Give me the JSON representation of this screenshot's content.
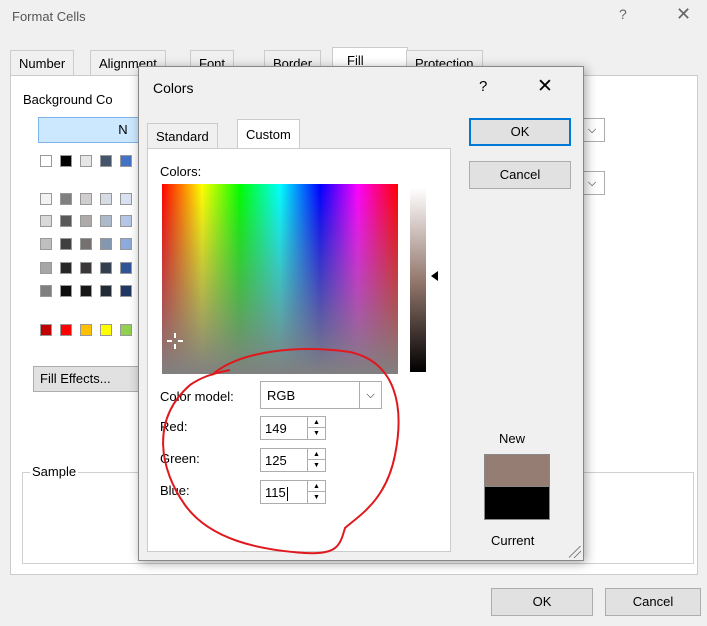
{
  "format_cells": {
    "title": "Format Cells",
    "help": "?",
    "close": "✕",
    "tabs": [
      "Number",
      "Alignment",
      "Font",
      "Border",
      "Fill",
      "Protection"
    ],
    "background_color_label": "Background Co",
    "no_color_label": "N",
    "fill_effects_label": "Fill Effects...",
    "sample_label": "Sample",
    "ok_label": "OK",
    "cancel_label": "Cancel",
    "dropdown_glyph": "⌵"
  },
  "colors_dialog": {
    "title": "Colors",
    "help": "?",
    "close": "✕",
    "tabs": {
      "standard": "Standard",
      "custom": "Custom"
    },
    "colors_label": "Colors:",
    "color_model_label": "Color model:",
    "color_model_value": "RGB",
    "red_label": "Red:",
    "red_value": "149",
    "green_label": "Green:",
    "green_value": "125",
    "blue_label": "Blue:",
    "blue_value": "115",
    "ok_label": "OK",
    "cancel_label": "Cancel",
    "new_label": "New",
    "current_label": "Current",
    "new_color": "#957d73",
    "current_color": "#000000"
  },
  "colors": {
    "accent": "#0078d7",
    "selection": "#cce8ff",
    "annotation": "#e0191e"
  }
}
